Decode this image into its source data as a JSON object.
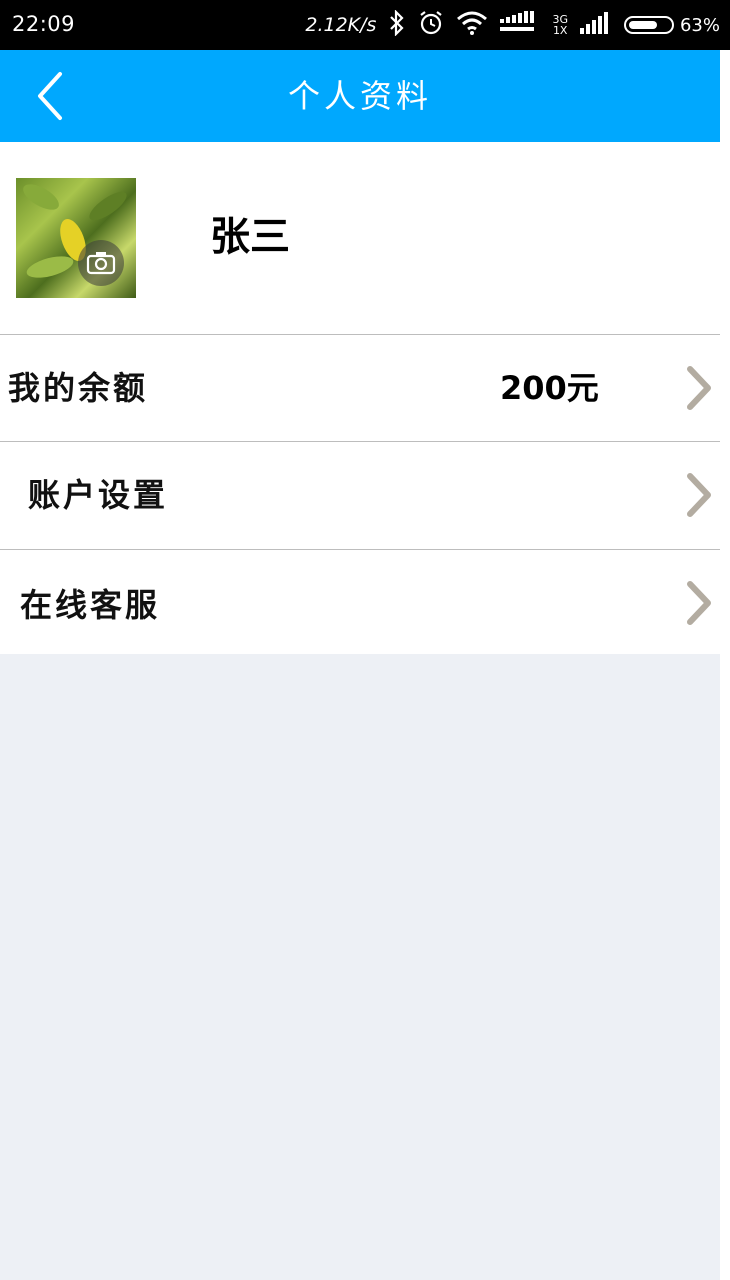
{
  "status_bar": {
    "time": "22:09",
    "speed": "2.12K/s",
    "network_top": "3G",
    "network_bottom": "1X",
    "battery": "63%",
    "icons": [
      "bluetooth-icon",
      "alarm-icon",
      "wifi-icon",
      "data-signal-icon",
      "cell-signal-icon",
      "battery-icon"
    ]
  },
  "header": {
    "title": "个人资料",
    "back_icon": "chevron-left-icon",
    "color": "#00a8fe"
  },
  "profile": {
    "name": "张三",
    "avatar_overlay_icon": "camera-icon"
  },
  "menu": {
    "items": [
      {
        "label": "我的余额",
        "value": "200元",
        "icon": "chevron-right-icon"
      },
      {
        "label": "账户设置",
        "icon": "chevron-right-icon"
      },
      {
        "label": "在线客服",
        "icon": "chevron-right-icon"
      }
    ]
  }
}
